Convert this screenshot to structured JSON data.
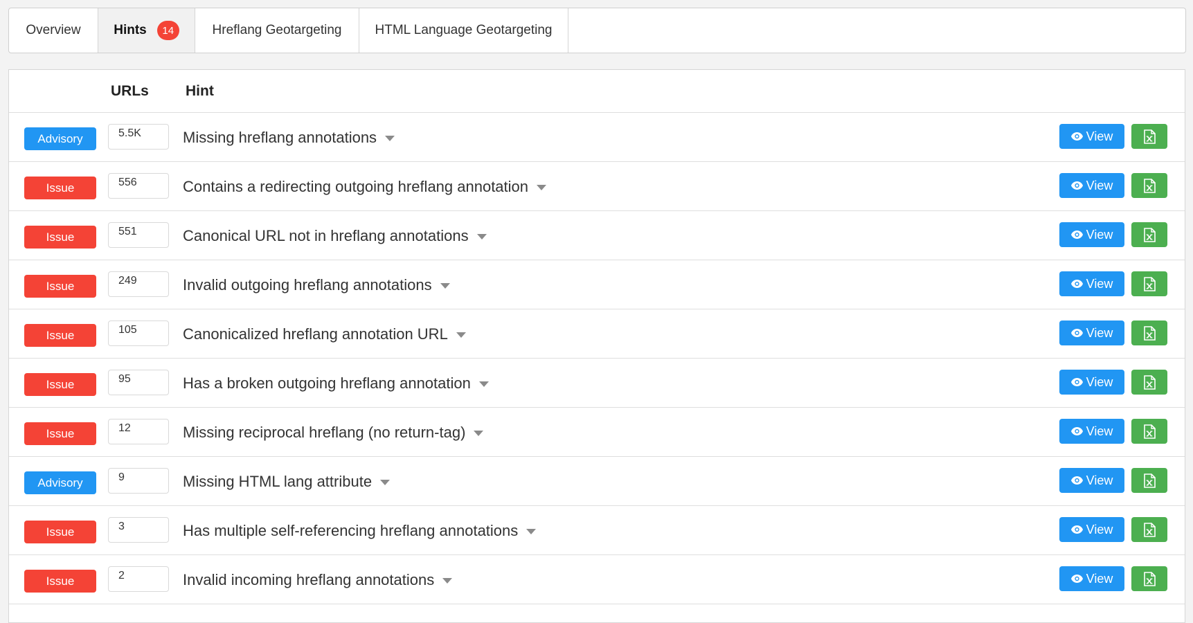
{
  "tabs": [
    {
      "label": "Overview",
      "active": false
    },
    {
      "label": "Hints",
      "active": true,
      "count": "14"
    },
    {
      "label": "Hreflang Geotargeting",
      "active": false
    },
    {
      "label": "HTML Language Geotargeting",
      "active": false
    }
  ],
  "table": {
    "headers": {
      "urls": "URLs",
      "hint": "Hint"
    },
    "view_label": "View",
    "rows": [
      {
        "type": "Advisory",
        "urls": "5.5K",
        "hint": "Missing hreflang annotations"
      },
      {
        "type": "Issue",
        "urls": "556",
        "hint": "Contains a redirecting outgoing hreflang annotation"
      },
      {
        "type": "Issue",
        "urls": "551",
        "hint": "Canonical URL not in hreflang annotations"
      },
      {
        "type": "Issue",
        "urls": "249",
        "hint": "Invalid outgoing hreflang annotations"
      },
      {
        "type": "Issue",
        "urls": "105",
        "hint": "Canonicalized hreflang annotation URL"
      },
      {
        "type": "Issue",
        "urls": "95",
        "hint": "Has a broken outgoing hreflang annotation"
      },
      {
        "type": "Issue",
        "urls": "12",
        "hint": "Missing reciprocal hreflang (no return-tag)"
      },
      {
        "type": "Advisory",
        "urls": "9",
        "hint": "Missing HTML lang attribute"
      },
      {
        "type": "Issue",
        "urls": "3",
        "hint": "Has multiple self-referencing hreflang annotations"
      },
      {
        "type": "Issue",
        "urls": "2",
        "hint": "Invalid incoming hreflang annotations"
      }
    ]
  },
  "colors": {
    "issue": "#f44336",
    "advisory": "#2196f3",
    "view": "#2196f3",
    "excel": "#4caf50"
  }
}
